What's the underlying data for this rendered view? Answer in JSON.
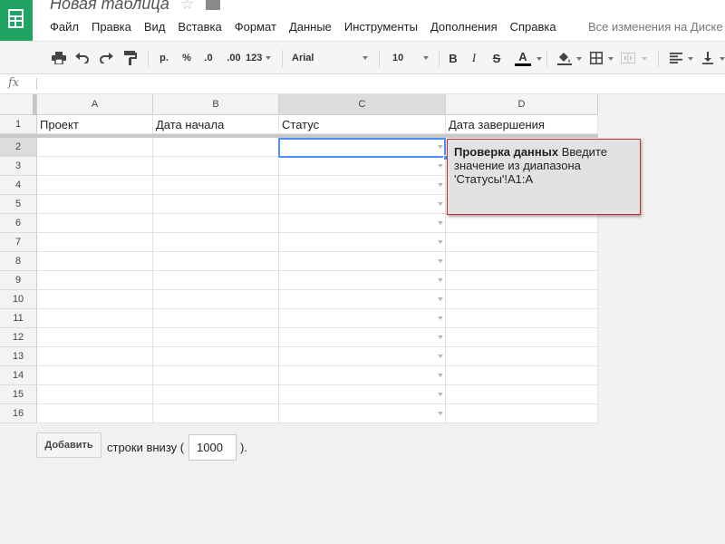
{
  "app": {
    "title": "Новая таблица",
    "star_glyph": "☆",
    "save_status": "Все изменения на Диске"
  },
  "menu": [
    "Файл",
    "Правка",
    "Вид",
    "Вставка",
    "Формат",
    "Данные",
    "Инструменты",
    "Дополнения",
    "Справка"
  ],
  "toolbar": {
    "format_currency": "р.",
    "format_percent": "%",
    "decimal_decrease": ".0",
    "decimal_increase": ".00",
    "format_more": "123",
    "font_family": "Arial",
    "font_size": "10",
    "bold": "B",
    "italic": "I",
    "strike": "S",
    "text_color": "A",
    "text_color_value": "#000000",
    "icons": [
      "print-icon",
      "undo-icon",
      "redo-icon",
      "paint-format-icon",
      "fill-color-icon",
      "borders-icon",
      "merge-cells-icon",
      "align-left-icon",
      "valign-bottom-icon"
    ]
  },
  "formula_bar": {
    "fx": "fx",
    "value": ""
  },
  "grid": {
    "columns": [
      "A",
      "B",
      "C",
      "D"
    ],
    "rows": [
      "1",
      "2",
      "3",
      "4",
      "5",
      "6",
      "7",
      "8",
      "9",
      "10",
      "11",
      "12",
      "13",
      "14",
      "15",
      "16"
    ],
    "header_row": [
      "Проект",
      "Дата начала",
      "Статус",
      "Дата завершения"
    ],
    "selected_cell": "C2"
  },
  "tooltip": {
    "bold": "Проверка данных",
    "text": "Введите значение из диапазона 'Статусы'!A1:A"
  },
  "add_rows": {
    "button": "Добавить",
    "label": "строки внизу (",
    "value": "1000",
    "close": ")."
  },
  "colors": {
    "brand": "#1fa463",
    "selection": "#4d90fe",
    "tooltip_border": "#c4302b"
  }
}
